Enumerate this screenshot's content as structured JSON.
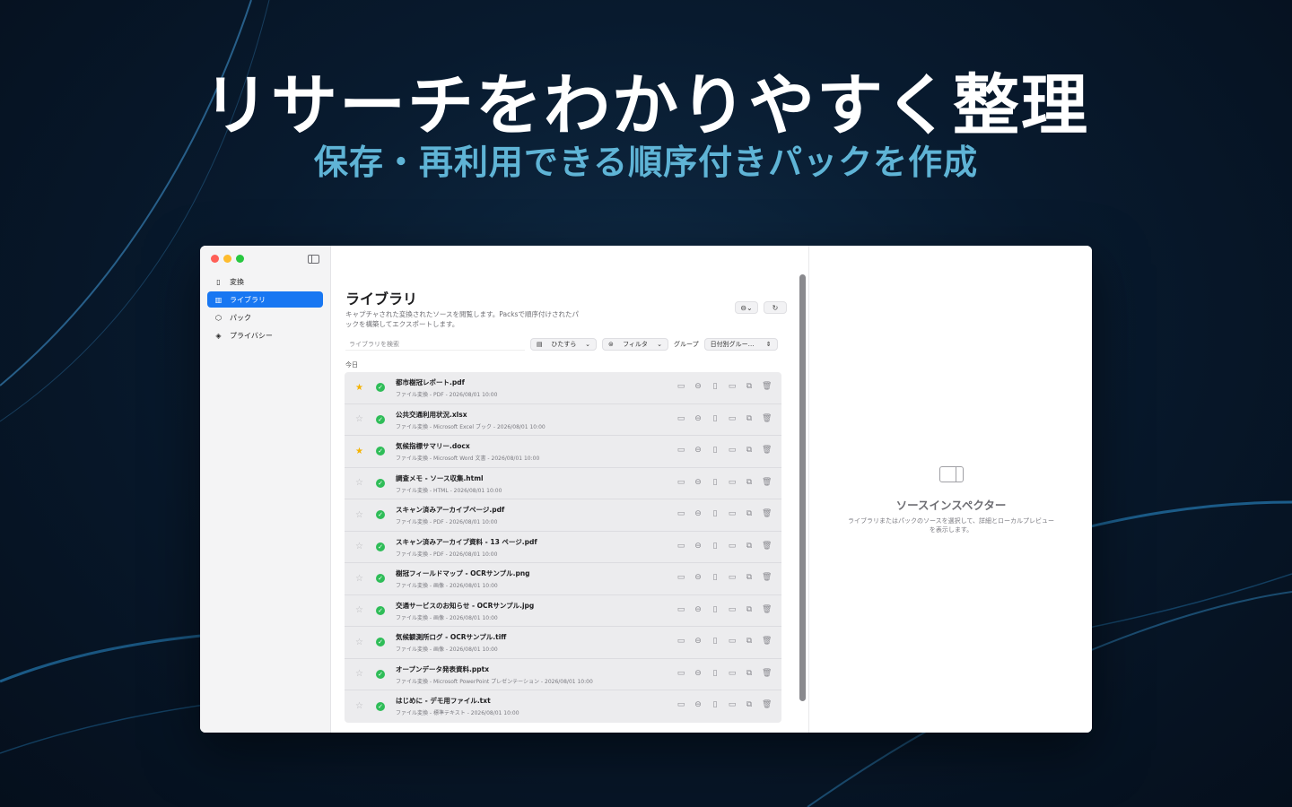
{
  "hero": {
    "headline": "リサーチをわかりやすく整理",
    "subheadline": "保存・再利用できる順序付きパックを作成"
  },
  "colors": {
    "accent": "#1877f2",
    "subheadline": "#5fb4d6",
    "success": "#2fbd58",
    "star": "#f5b301"
  },
  "sidebar": {
    "items": [
      {
        "label": "変換",
        "icon": "document-icon",
        "active": false
      },
      {
        "label": "ライブラリ",
        "icon": "books-icon",
        "active": true
      },
      {
        "label": "パック",
        "icon": "package-icon",
        "active": false
      },
      {
        "label": "プライバシー",
        "icon": "shield-icon",
        "active": false
      }
    ]
  },
  "library": {
    "title": "ライブラリ",
    "description": "キャプチャされた変換されたソースを閲覧します。Packsで順序付けされたパックを構築してエクスポートします。",
    "search_placeholder": "ライブラリを検索",
    "sort_label": "ひたすら",
    "filter_label": "フィルタ",
    "group_label": "グループ",
    "group_value": "日付別グルー…",
    "section": "今日",
    "rows": [
      {
        "name": "都市樹冠レポート.pdf",
        "meta": "ファイル変換 - PDF - 2026/08/01 10:00",
        "starred": true
      },
      {
        "name": "公共交通利用状況.xlsx",
        "meta": "ファイル変換 - Microsoft Excel ブック - 2026/08/01 10:00",
        "starred": false
      },
      {
        "name": "気候指標サマリー.docx",
        "meta": "ファイル変換 - Microsoft Word 文書 - 2026/08/01 10:00",
        "starred": true
      },
      {
        "name": "調査メモ - ソース収集.html",
        "meta": "ファイル変換 - HTML - 2026/08/01 10:00",
        "starred": false
      },
      {
        "name": "スキャン済みアーカイブページ.pdf",
        "meta": "ファイル変換 - PDF - 2026/08/01 10:00",
        "starred": false
      },
      {
        "name": "スキャン済みアーカイブ資料 - 13 ページ.pdf",
        "meta": "ファイル変換 - PDF - 2026/08/01 10:00",
        "starred": false
      },
      {
        "name": "樹冠フィールドマップ - OCRサンプル.png",
        "meta": "ファイル変換 - 画像 - 2026/08/01 10:00",
        "starred": false
      },
      {
        "name": "交通サービスのお知らせ - OCRサンプル.jpg",
        "meta": "ファイル変換 - 画像 - 2026/08/01 10:00",
        "starred": false
      },
      {
        "name": "気候観測所ログ - OCRサンプル.tiff",
        "meta": "ファイル変換 - 画像 - 2026/08/01 10:00",
        "starred": false
      },
      {
        "name": "オープンデータ発表資料.pptx",
        "meta": "ファイル変換 - Microsoft PowerPoint プレゼンテーション - 2026/08/01 10:00",
        "starred": false
      },
      {
        "name": "はじめに - デモ用ファイル.txt",
        "meta": "ファイル変換 - 標準テキスト - 2026/08/01 10:00",
        "starred": false
      }
    ]
  },
  "inspector": {
    "title": "ソースインスペクター",
    "description": "ライブラリまたはパックのソースを選択して、詳細とローカルプレビューを表示します。"
  }
}
